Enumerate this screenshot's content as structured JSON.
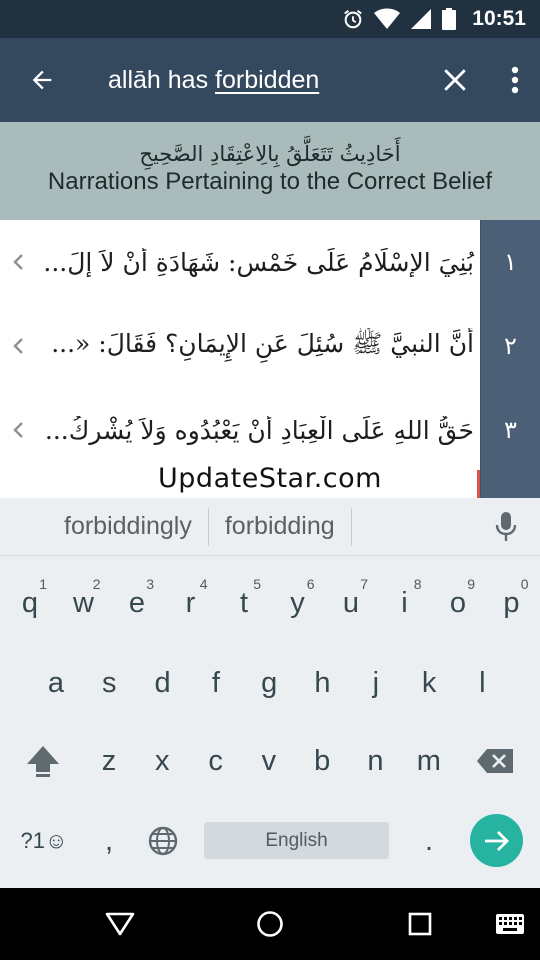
{
  "status_bar": {
    "time": "10:51"
  },
  "app_bar": {
    "query_prefix": "allāh has ",
    "query_word": "forbidden"
  },
  "section": {
    "arabic_title": "أَحَادِيثُ تَتَعَلَّقُ بِالِاعْتِقَادِ الصَّحِيحِ",
    "english_title": "Narrations Pertaining to the Correct Belief"
  },
  "list": {
    "items": [
      {
        "number": "١",
        "text": "بُنِيَ الإِسْلَامُ عَلَى خَمْسٍ: شَهَادَةِ أَنْ لاَ إِلَ..."
      },
      {
        "number": "٢",
        "text": "أَنَّ النبيَّ ﷺ سُئِلَ عَنِ الإِيمَانِ؟ فَقَالَ: «..."
      },
      {
        "number": "٣",
        "text": "حَقُّ اللهِ عَلَى الْعِبَادِ أَنْ يَعْبُدُوه وَلاَ يُشْرِكُ..."
      },
      {
        "number": "",
        "text": ""
      }
    ]
  },
  "watermark": "UpdateStar.com",
  "suggestions": {
    "left": "forbiddingly",
    "right": "forbidding"
  },
  "keyboard": {
    "row1": [
      {
        "label": "q",
        "hint": "1"
      },
      {
        "label": "w",
        "hint": "2"
      },
      {
        "label": "e",
        "hint": "3"
      },
      {
        "label": "r",
        "hint": "4"
      },
      {
        "label": "t",
        "hint": "5"
      },
      {
        "label": "y",
        "hint": "6"
      },
      {
        "label": "u",
        "hint": "7"
      },
      {
        "label": "i",
        "hint": "8"
      },
      {
        "label": "o",
        "hint": "9"
      },
      {
        "label": "p",
        "hint": "0"
      }
    ],
    "row2": [
      "a",
      "s",
      "d",
      "f",
      "g",
      "h",
      "j",
      "k",
      "l"
    ],
    "row3": [
      "z",
      "x",
      "c",
      "v",
      "b",
      "n",
      "m"
    ],
    "symbols_label": "?1☺",
    "comma_label": ",",
    "period_label": ".",
    "space_label": "English"
  },
  "colors": {
    "status_bar": "#22313f",
    "app_bar": "#34495e",
    "section_header": "#a9bbba",
    "number_column": "#4b6076",
    "enter_key": "#26b3a0",
    "keyboard_bg": "#eceff1"
  }
}
